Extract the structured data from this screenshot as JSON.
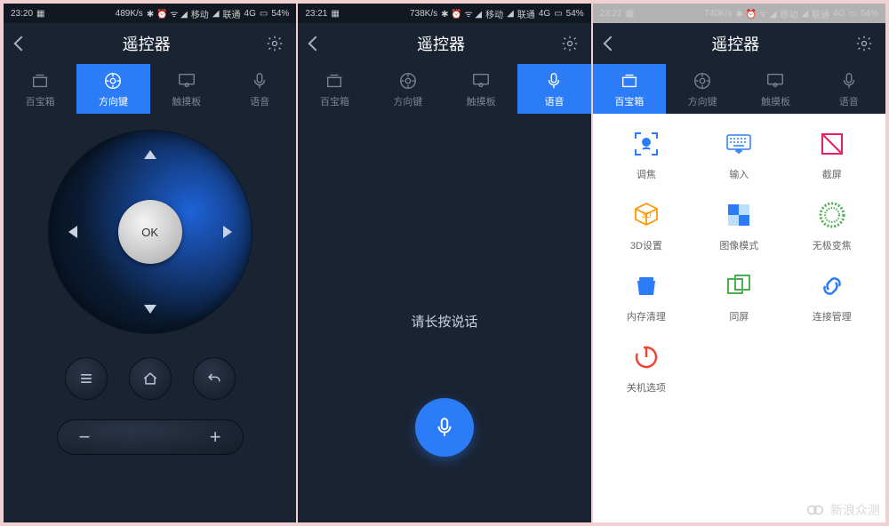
{
  "statusbar": {
    "s1": {
      "time": "23:20",
      "speed": "489K/s",
      "carrier1": "移动",
      "carrier2": "联通",
      "net": "4G",
      "battery": "54%"
    },
    "s2": {
      "time": "23:21",
      "speed": "738K/s",
      "carrier1": "移动",
      "carrier2": "联通",
      "net": "4G",
      "battery": "54%"
    },
    "s3": {
      "time": "23:21",
      "speed": "740K/s",
      "carrier1": "移动",
      "carrier2": "联通",
      "net": "4G",
      "battery": "54%"
    }
  },
  "titlebar": {
    "title": "遥控器"
  },
  "tabs": {
    "toolbox": "百宝箱",
    "dpad": "方向键",
    "touchpad": "触摸板",
    "voice": "语音"
  },
  "dpad": {
    "ok": "OK"
  },
  "volume": {
    "minus": "−",
    "plus": "+"
  },
  "voice": {
    "prompt": "请长按说话"
  },
  "toolbox": {
    "items": {
      "focus": "调焦",
      "input": "输入",
      "screenshot": "截屏",
      "threed": "3D设置",
      "imagemode": "图像模式",
      "zoom": "无极变焦",
      "memclean": "内存清理",
      "mirror": "同屏",
      "connection": "连接管理",
      "poweropts": "关机选项"
    }
  },
  "watermark": "新浪众测"
}
